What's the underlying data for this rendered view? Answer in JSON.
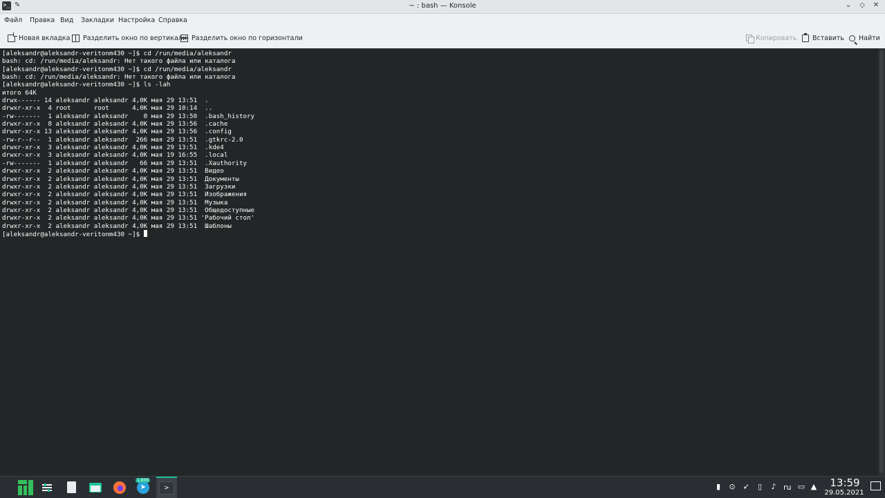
{
  "window": {
    "title": "~ : bash — Konsole",
    "app_icon": ">_",
    "pin_icon": "✎",
    "btn_minimize": "⌄",
    "btn_maximize": "◇",
    "btn_close": "✕"
  },
  "menu": [
    "Файл",
    "Правка",
    "Вид",
    "Закладки",
    "Настройка",
    "Справка"
  ],
  "toolbar": {
    "new_tab": "Новая вкладка",
    "split_vertical": "Разделить окно по вертикали",
    "split_horizontal": "Разделить окно по горизонтали",
    "copy": "Копировать",
    "paste": "Вставить",
    "find": "Найти"
  },
  "terminal": {
    "lines": [
      "[aleksandr@aleksandr-veritonm430 ~]$ cd /run/media/aleksandr",
      "bash: cd: /run/media/aleksandr: Нет такого файла или каталога",
      "[aleksandr@aleksandr-veritonm430 ~]$ cd /run/media/aleksandr",
      "bash: cd: /run/media/aleksandr: Нет такого файла или каталога",
      "[aleksandr@aleksandr-veritonm430 ~]$ ls -lah",
      "итого 64K",
      "drwx------ 14 aleksandr aleksandr 4,0K мая 29 13:51  .",
      "drwxr-xr-x  4 root      root      4,0K мая 29 10:14  ..",
      "-rw-------  1 aleksandr aleksandr    0 мая 29 13:50  .bash_history",
      "drwxr-xr-x  8 aleksandr aleksandr 4,0K мая 29 13:56  .cache",
      "drwxr-xr-x 13 aleksandr aleksandr 4,0K мая 29 13:56  .config",
      "-rw-r--r--  1 aleksandr aleksandr  266 мая 29 13:51  .gtkrc-2.0",
      "drwxr-xr-x  3 aleksandr aleksandr 4,0K мая 29 13:51  .kde4",
      "drwxr-xr-x  3 aleksandr aleksandr 4,0K мая 19 16:55  .local",
      "-rw-------  1 aleksandr aleksandr   66 мая 29 13:51  .Xauthority",
      "drwxr-xr-x  2 aleksandr aleksandr 4,0K мая 29 13:51  Видео",
      "drwxr-xr-x  2 aleksandr aleksandr 4,0K мая 29 13:51  Документы",
      "drwxr-xr-x  2 aleksandr aleksandr 4,0K мая 29 13:51  Загрузки",
      "drwxr-xr-x  2 aleksandr aleksandr 4,0K мая 29 13:51  Изображения",
      "drwxr-xr-x  2 aleksandr aleksandr 4,0K мая 29 13:51  Музыка",
      "drwxr-xr-x  2 aleksandr aleksandr 4,0K мая 29 13:51  Общедоступные",
      "drwxr-xr-x  2 aleksandr aleksandr 4,0K мая 29 13:51 'Рабочий стол'",
      "drwxr-xr-x  2 aleksandr aleksandr 4,0K мая 29 13:51  Шаблоны"
    ],
    "prompt": "[aleksandr@aleksandr-veritonm430 ~]$ "
  },
  "taskbar": {
    "apps": [
      {
        "name": "application-menu",
        "icon": "manjaro-logo-icon"
      },
      {
        "name": "system-settings",
        "icon": "settings-icon"
      },
      {
        "name": "text-editor",
        "icon": "document-icon"
      },
      {
        "name": "file-manager",
        "icon": "folder-icon"
      },
      {
        "name": "firefox",
        "icon": "firefox-icon"
      },
      {
        "name": "telegram",
        "icon": "telegram-icon"
      },
      {
        "name": "konsole",
        "icon": "terminal-icon"
      }
    ],
    "telegram_badge": "1,830",
    "tray": {
      "language": "ru",
      "time": "13:59",
      "date": "29.05.2021"
    }
  },
  "colors": {
    "terminal_bg": "#232627",
    "terminal_fg": "#fcfcfc",
    "chrome_bg": "#eff0f1",
    "taskbar_bg": "#2a2e32",
    "accent": "#1abc9c"
  }
}
